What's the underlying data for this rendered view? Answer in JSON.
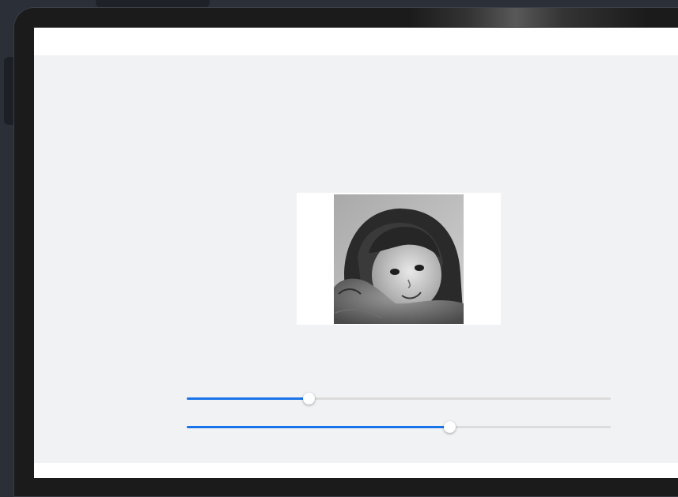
{
  "photo": {
    "icon": "portrait-photo",
    "style": "black-and-white",
    "subject": "girl-with-cat"
  },
  "sliders": [
    {
      "name": "slider-1",
      "value": 0.287,
      "accent": "#1a73e8",
      "track": "#dcdcdc"
    },
    {
      "name": "slider-2",
      "value": 0.62,
      "accent": "#1a73e8",
      "track": "#dcdcdc"
    }
  ],
  "colors": {
    "screen_bg": "#f1f2f4",
    "bar_bg": "#ffffff",
    "device_bezel": "#1b1b1b",
    "outer_bg": "#2b2f38"
  }
}
